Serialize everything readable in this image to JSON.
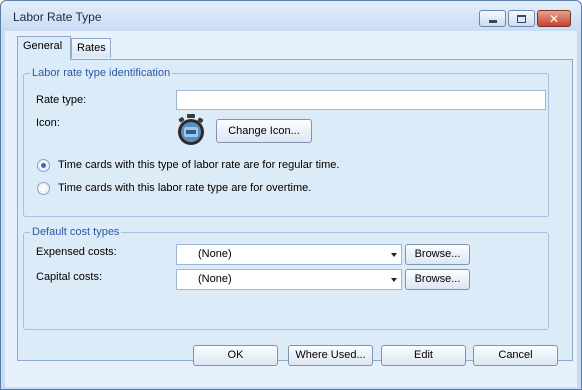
{
  "window": {
    "title": "Labor Rate Type",
    "minimize_icon": "minimize-icon",
    "maximize_icon": "maximize-icon",
    "close_icon": "close-icon"
  },
  "tabs": [
    {
      "label": "General",
      "active": true
    },
    {
      "label": "Rates",
      "active": false
    }
  ],
  "identification": {
    "title": "Labor rate type identification",
    "rate_type_label": "Rate type:",
    "rate_type_value": "",
    "icon_label": "Icon:",
    "icon_name": "stopwatch-icon",
    "change_icon_button": "Change Icon...",
    "radio_regular": "Time cards with this type of labor rate are for regular time.",
    "radio_overtime": "Time cards with this labor rate type are for overtime.",
    "selected": "regular"
  },
  "cost_types": {
    "title": "Default cost types",
    "expensed_label": "Expensed costs:",
    "expensed_value": "(None)",
    "capital_label": "Capital costs:",
    "capital_value": "(None)",
    "browse_label": "Browse..."
  },
  "buttons": {
    "ok": "OK",
    "where_used": "Where Used...",
    "edit": "Edit",
    "cancel": "Cancel"
  }
}
